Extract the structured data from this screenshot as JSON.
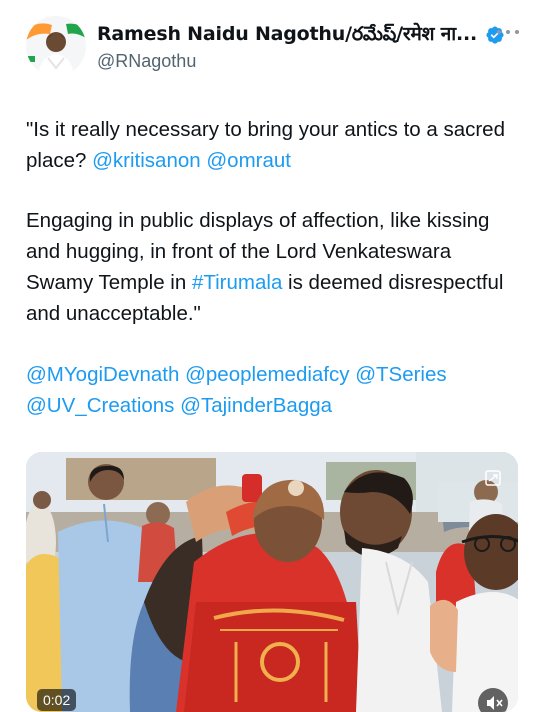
{
  "author": {
    "display_name": "Ramesh Naidu Nagothu/రమేష్/रमेश ना...",
    "handle": "@RNagothu",
    "verified_color": "#1d9bf0",
    "avatar_icon": "profile-photo"
  },
  "tweet": {
    "p1_text_a": "\"Is it really necessary to bring your antics to a sacred place? ",
    "p1_mention_1": "@kritisanon",
    "p1_mention_2": "@omraut",
    "p2_text_a": "Engaging in public displays of affection, like kissing and hugging, in front of the Lord Venkateswara Swamy Temple in ",
    "p2_hashtag": "#Tirumala",
    "p2_text_b": " is deemed disrespectful and unacceptable.\"",
    "p3_mention_1": "@MYogiDevnath",
    "p3_mention_2": "@peoplemediafcy",
    "p3_mention_3": "@TSeries",
    "p3_mention_4": "@UV_Creations",
    "p3_mention_5": "@TajinderBagga"
  },
  "media": {
    "duration": "0:02",
    "link_color": "#1d9bf0"
  }
}
